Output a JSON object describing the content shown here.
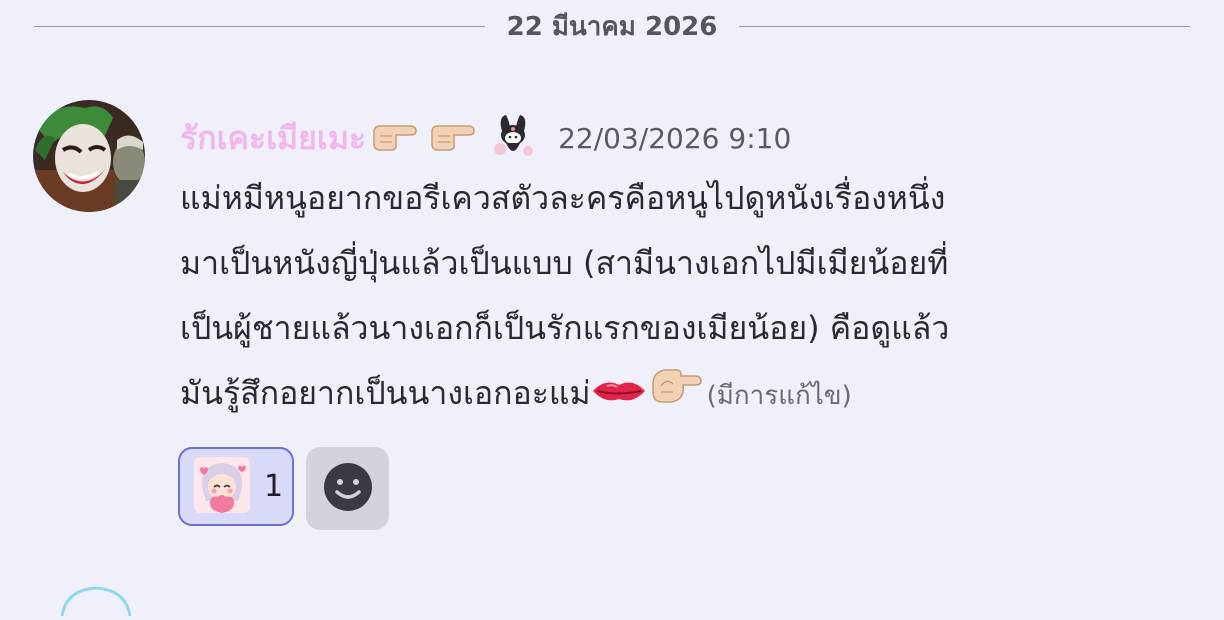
{
  "date_divider": {
    "text": "22 มีนาคม 2026"
  },
  "message": {
    "username": "รักเคะเมียเมะ",
    "username_emojis": [
      "pointing-right-emoji",
      "pointing-right-emoji",
      "kuromi-sticker-emoji"
    ],
    "timestamp": "22/03/2026 9:10",
    "lines": [
      "แม่หมีหนูอยากขอรีเควสตัวละครคือหนูไปดูหนังเรื่องหนึ่ง",
      "มาเป็นหนังญี่ปุ่นแล้วเป็นแบบ (สามีนางเอกไปมีเมียน้อยที่",
      "เป็นผู้ชายแล้วนางเอกก็เป็นรักแรกของเมียน้อย) คือดูแล้ว",
      "มันรู้สึกอยากเป็นนางเอกอะแม่"
    ],
    "trailing_emojis": [
      "lips-emoji",
      "pinching-hand-emoji"
    ],
    "edited_label": "(มีการแก้ไข)"
  },
  "reactions": [
    {
      "icon": "anime-girl-heart-sticker",
      "count": "1",
      "selected": true
    }
  ],
  "colors": {
    "background": "#f0f0fa",
    "username": "#f2b6ee",
    "reaction_border": "#6c70d6",
    "reaction_bg": "#d8daf8",
    "add_reaction_bg": "#d3d3dc"
  }
}
